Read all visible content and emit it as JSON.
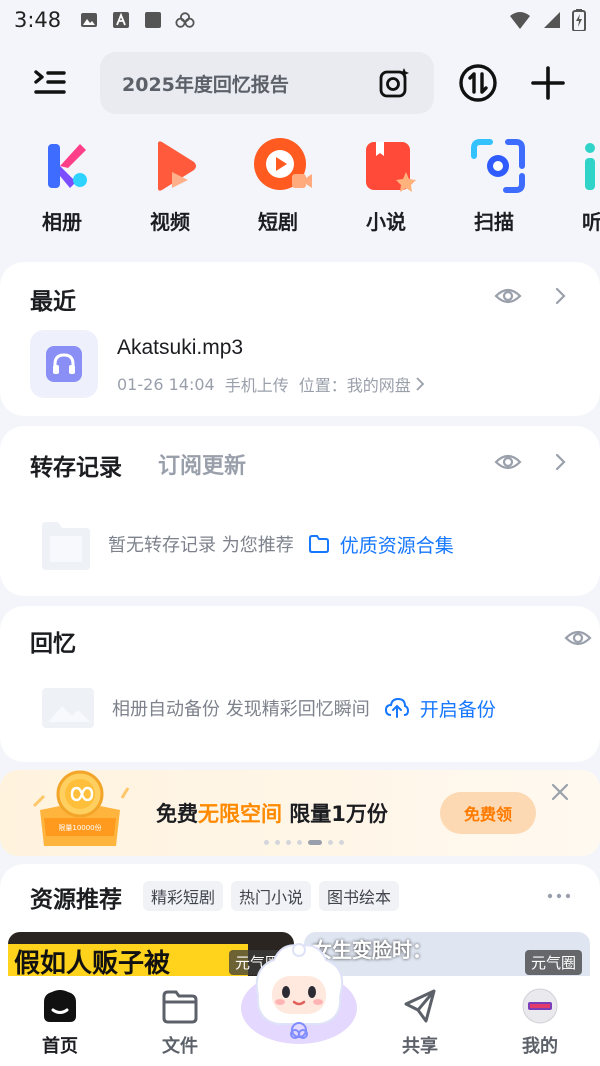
{
  "status_bar": {
    "time": "3:48"
  },
  "header": {
    "search_placeholder": "2025年度回忆报告"
  },
  "apps": [
    {
      "label": "相册",
      "icon": "photo-album-icon"
    },
    {
      "label": "视频",
      "icon": "video-play-icon"
    },
    {
      "label": "短剧",
      "icon": "short-drama-icon"
    },
    {
      "label": "小说",
      "icon": "novel-book-icon"
    },
    {
      "label": "扫描",
      "icon": "scan-icon"
    },
    {
      "label": "听",
      "icon": "listen-icon"
    }
  ],
  "recent": {
    "title": "最近",
    "file": {
      "name": "Akatsuki.mp3",
      "date": "01-26 14:04",
      "source": "手机上传",
      "location": "位置：我的网盘"
    }
  },
  "transfer": {
    "title": "转存记录",
    "subtitle": "订阅更新",
    "empty_text": "暂无转存记录 为您推荐",
    "link_text": "优质资源合集"
  },
  "memory": {
    "title": "回忆",
    "empty_text": "相册自动备份 发现精彩回忆瞬间",
    "link_text": "开启备份"
  },
  "banner": {
    "text_before": "免费",
    "text_highlight": "无限空间",
    "text_after": " 限量1万份",
    "button": "免费领",
    "art_caption": "限量10000份",
    "highlight_color": "#ff8a00"
  },
  "resources": {
    "title": "资源推荐",
    "tabs": [
      "精彩短剧",
      "热门小说",
      "图书绘本"
    ],
    "cards": [
      {
        "poster_text": "假如人贩子被",
        "tag": "元气圈"
      },
      {
        "poster_text": "女生变脸时：",
        "tag": "元气圈"
      }
    ]
  },
  "bottom_nav": [
    {
      "label": "首页",
      "active": true
    },
    {
      "label": "文件",
      "active": false
    },
    {
      "label": "共享",
      "active": false
    },
    {
      "label": "我的",
      "active": false
    }
  ],
  "colors": {
    "accent": "#1677ff",
    "background": "#f3f5fa"
  }
}
